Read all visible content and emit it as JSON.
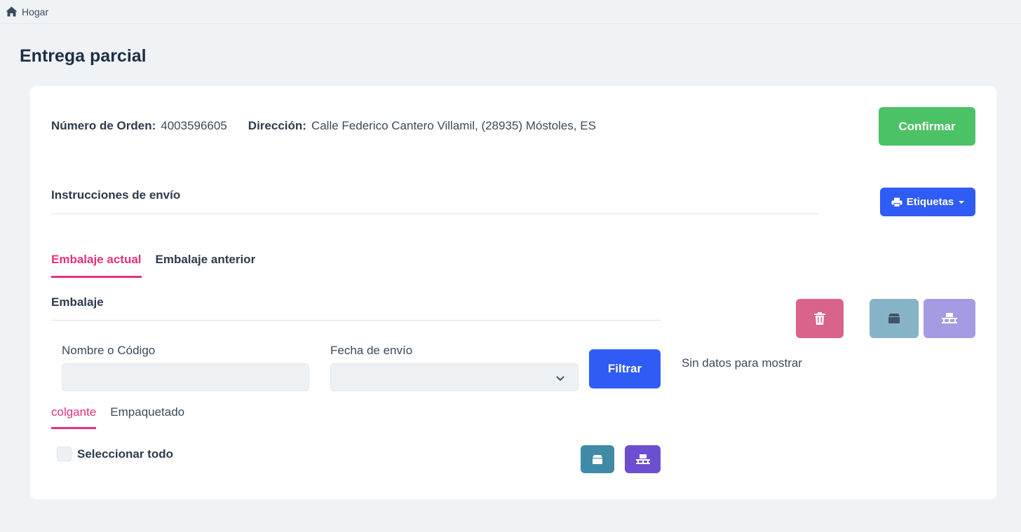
{
  "breadcrumb": {
    "home_label": "Hogar",
    "home_icon": "home-icon"
  },
  "page": {
    "title": "Entrega parcial"
  },
  "order": {
    "number_label": "Número de Orden:",
    "number_value": "4003596605",
    "address_label": "Dirección:",
    "address_value": "Calle Federico Cantero Villamil, (28935) Móstoles, ES"
  },
  "actions": {
    "confirm_label": "Confirmar",
    "labels_label": "Etiquetas",
    "labels_icon": "printer-icon"
  },
  "shipping": {
    "title": "Instrucciones de envío"
  },
  "tabs": [
    {
      "label": "Embalaje actual",
      "active": true
    },
    {
      "label": "Embalaje anterior",
      "active": false
    }
  ],
  "packing": {
    "title": "Embalaje",
    "name_label": "Nombre o Código",
    "name_value": "",
    "date_label": "Fecha de envío",
    "date_value": "",
    "filter_label": "Filtrar",
    "subtabs": [
      {
        "label": "colgante",
        "active": true
      },
      {
        "label": "Empaquetado",
        "active": false
      }
    ],
    "select_all_label": "Seleccionar todo",
    "select_all_checked": false
  },
  "right_panel": {
    "empty_text": "Sin datos para mostrar"
  },
  "colors": {
    "accent": "#e6307f",
    "primary": "#2f5cf5",
    "success": "#4cc266",
    "danger_light": "#d9638a",
    "box_light": "#86b3c6",
    "pallet_light": "#a49be3",
    "box": "#3f8aa6",
    "pallet": "#6c4fcf"
  }
}
